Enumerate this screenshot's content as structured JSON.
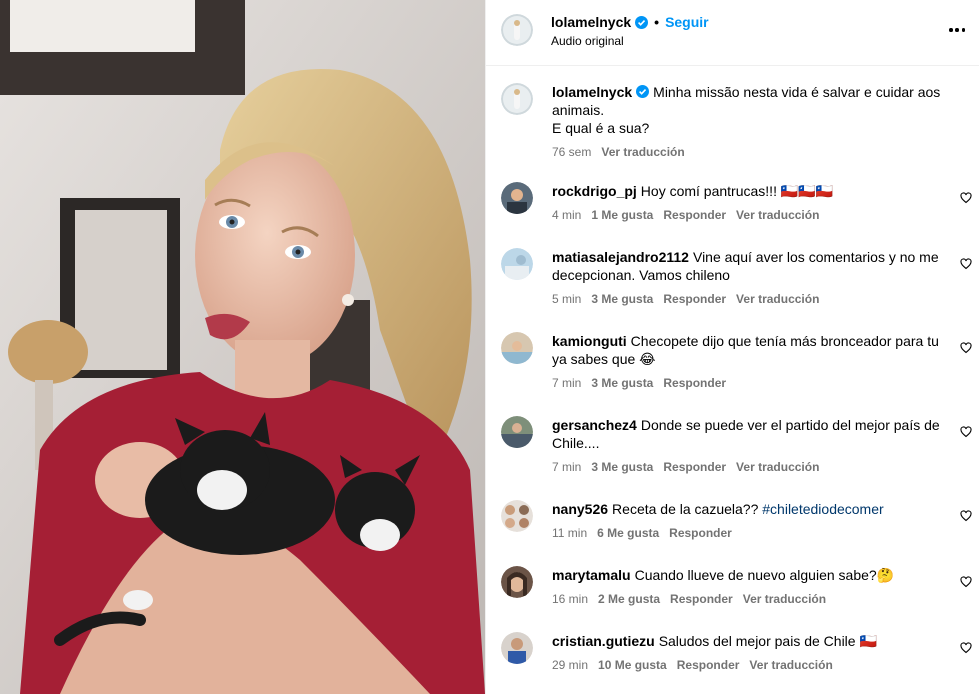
{
  "header": {
    "username": "lolamelnyck",
    "dot": "•",
    "follow_label": "Seguir",
    "subtitle": "Audio original",
    "more_icon": "more-horizontal-icon"
  },
  "caption": {
    "username": "lolamelnyck",
    "text_line1": "Minha missão nesta vida é salvar e cuidar aos animais.",
    "text_line2": "E qual é a sua?",
    "time": "76 sem",
    "translate": "Ver traducción"
  },
  "comments": [
    {
      "username": "rockdrigo_pj",
      "text": "Hoy comí pantrucas!!! 🇨🇱🇨🇱🇨🇱",
      "time": "4 min",
      "likes": "1 Me gusta",
      "reply": "Responder",
      "translate": "Ver traducción"
    },
    {
      "username": "matiasalejandro2112",
      "text": "Vine aquí aver los comentarios y no me decepcionan. Vamos chileno",
      "time": "5 min",
      "likes": "3 Me gusta",
      "reply": "Responder",
      "translate": "Ver traducción"
    },
    {
      "username": "kamionguti",
      "text": "Checopete dijo que tenía más bronceador para tu ya sabes que 😂",
      "time": "7 min",
      "likes": "3 Me gusta",
      "reply": "Responder",
      "translate": ""
    },
    {
      "username": "gersanchez4",
      "text": "Donde se puede ver el partido del mejor país de Chile....",
      "time": "7 min",
      "likes": "3 Me gusta",
      "reply": "Responder",
      "translate": "Ver traducción"
    },
    {
      "username": "nany526",
      "text": "Receta de la cazuela??",
      "hashtag": "#chiletediodecomer",
      "time": "11 min",
      "likes": "6 Me gusta",
      "reply": "Responder",
      "translate": ""
    },
    {
      "username": "marytamalu",
      "text": "Cuando llueve de nuevo alguien sabe?🤔",
      "time": "16 min",
      "likes": "2 Me gusta",
      "reply": "Responder",
      "translate": "Ver traducción"
    },
    {
      "username": "cristian.gutiezu",
      "text": "Saludos del mejor pais de Chile 🇨🇱",
      "time": "29 min",
      "likes": "10 Me gusta",
      "reply": "Responder",
      "translate": "Ver traducción"
    }
  ],
  "colors": {
    "link": "#0095f6",
    "meta": "#737373",
    "hashtag": "#00376b",
    "verified": "#0095f6"
  }
}
